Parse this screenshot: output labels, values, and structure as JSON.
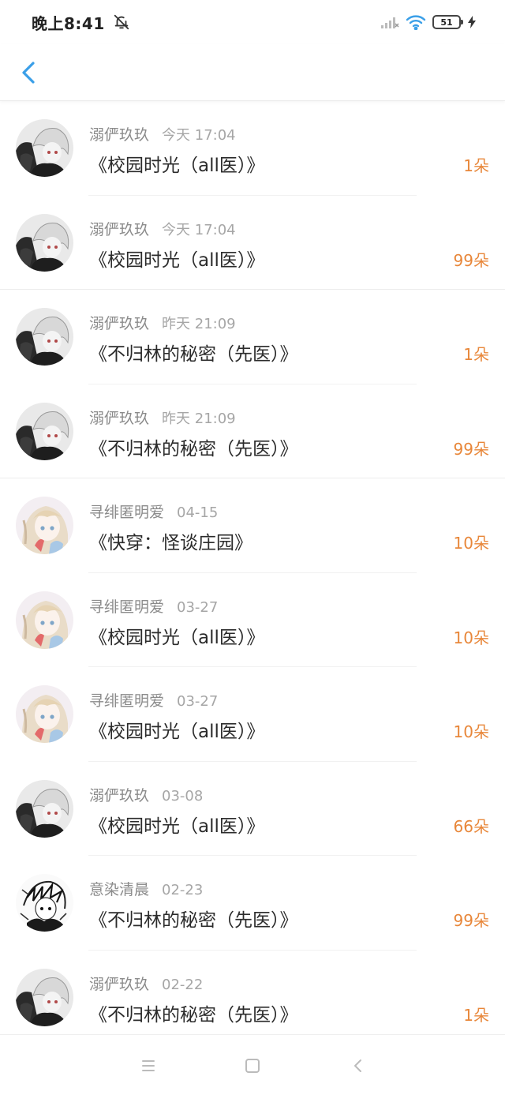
{
  "status_bar": {
    "time": "晚上8:41",
    "battery": "51",
    "icons": [
      "bell-off-icon",
      "signal-icon",
      "wifi-icon",
      "battery-icon",
      "charging-icon"
    ]
  },
  "header": {
    "back_icon": "chevron-left-icon"
  },
  "colors": {
    "accent": "#3a9fe8",
    "flower_count": "#e8873a"
  },
  "gift_records": [
    {
      "user": "溺俨玖玖",
      "time": "今天 17:04",
      "title": "《校园时光（all医）》",
      "count": "1朵",
      "avatar": "dark-hair-avatar"
    },
    {
      "user": "溺俨玖玖",
      "time": "今天 17:04",
      "title": "《校园时光（all医）》",
      "count": "99朵",
      "avatar": "dark-hair-avatar"
    },
    {
      "user": "溺俨玖玖",
      "time": "昨天 21:09",
      "title": "《不归林的秘密（先医）》",
      "count": "1朵",
      "avatar": "dark-hair-avatar"
    },
    {
      "user": "溺俨玖玖",
      "time": "昨天 21:09",
      "title": "《不归林的秘密（先医）》",
      "count": "99朵",
      "avatar": "dark-hair-avatar"
    },
    {
      "user": "寻绯匿明爱",
      "time": "04-15",
      "title": "《快穿：怪谈庄园》",
      "count": "10朵",
      "avatar": "pastel-girl-avatar"
    },
    {
      "user": "寻绯匿明爱",
      "time": "03-27",
      "title": "《校园时光（all医）》",
      "count": "10朵",
      "avatar": "pastel-girl-avatar"
    },
    {
      "user": "寻绯匿明爱",
      "time": "03-27",
      "title": "《校园时光（all医）》",
      "count": "10朵",
      "avatar": "pastel-girl-avatar"
    },
    {
      "user": "溺俨玖玖",
      "time": "03-08",
      "title": "《校园时光（all医）》",
      "count": "66朵",
      "avatar": "dark-hair-avatar"
    },
    {
      "user": "意染清晨",
      "time": "02-23",
      "title": "《不归林的秘密（先医）》",
      "count": "99朵",
      "avatar": "sketch-avatar"
    },
    {
      "user": "溺俨玖玖",
      "time": "02-22",
      "title": "《不归林的秘密（先医）》",
      "count": "1朵",
      "avatar": "dark-hair-avatar"
    }
  ],
  "nav_bar": {
    "icons": [
      "menu-icon",
      "home-square-icon",
      "back-triangle-icon"
    ]
  }
}
